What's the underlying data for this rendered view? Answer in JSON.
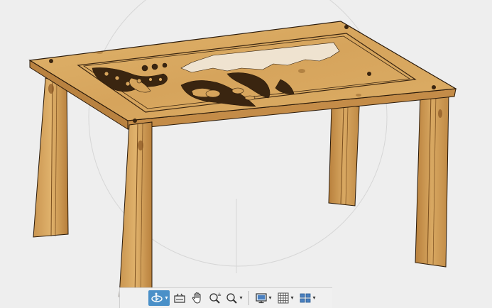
{
  "viewport": {
    "background": "#eeeeee",
    "model": "carved-wooden-table"
  },
  "colors": {
    "wood_top": "#d8a860",
    "wood_edge": "#c08a45",
    "wood_side": "#b9823f",
    "wood_dark": "#9a6a30",
    "wood_light": "#e6be7e",
    "outline": "#2a1a0a",
    "active_accent": "#4a90c8"
  },
  "toolbar": {
    "tools": [
      {
        "name": "orbit-icon",
        "active": true,
        "has_menu": true
      },
      {
        "name": "look-at-icon",
        "active": false,
        "has_menu": false
      },
      {
        "name": "pan-hand-icon",
        "active": false,
        "has_menu": false
      },
      {
        "name": "zoom-icon",
        "active": false,
        "has_menu": false
      },
      {
        "name": "zoom-window-icon",
        "active": false,
        "has_menu": true
      },
      {
        "name": "display-settings-icon",
        "active": false,
        "has_menu": true
      },
      {
        "name": "grid-icon",
        "active": false,
        "has_menu": true
      },
      {
        "name": "viewports-icon",
        "active": false,
        "has_menu": true
      }
    ]
  }
}
